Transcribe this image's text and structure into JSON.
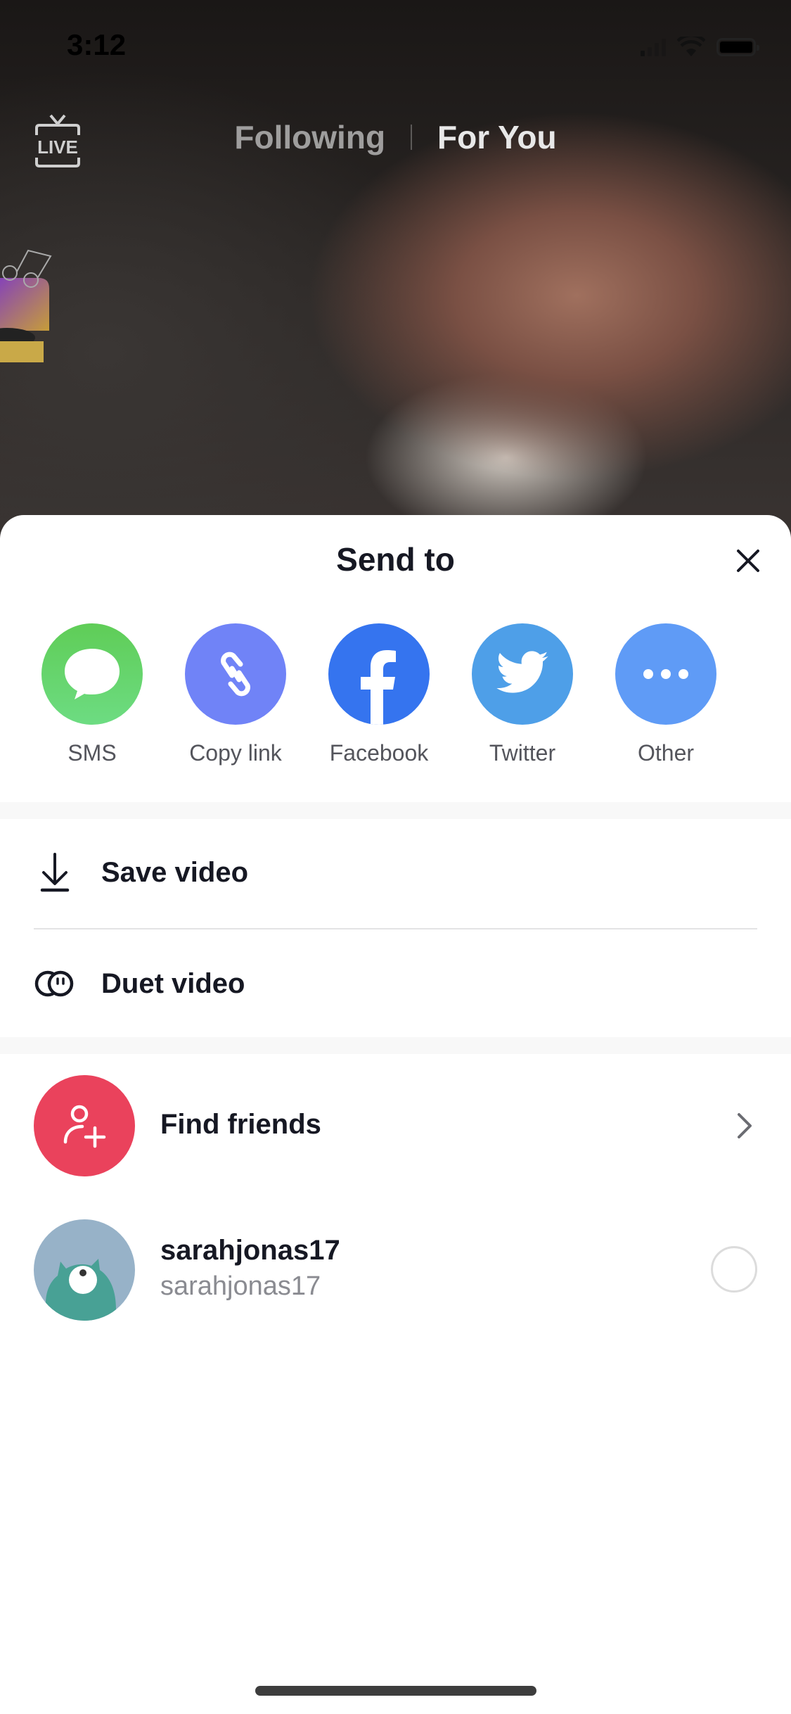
{
  "status_bar": {
    "time": "3:12"
  },
  "top_nav": {
    "live_label": "LIVE",
    "tabs": [
      {
        "label": "Following",
        "active": false
      },
      {
        "label": "For You",
        "active": true
      }
    ]
  },
  "share_sheet": {
    "title": "Send to",
    "close_icon": "close-icon",
    "share_targets": [
      {
        "label": "SMS",
        "icon": "message-bubble-icon",
        "color": "#5fd068"
      },
      {
        "label": "Copy link",
        "icon": "link-icon",
        "color": "#7083f7"
      },
      {
        "label": "Facebook",
        "icon": "facebook-icon",
        "color": "#3574ef"
      },
      {
        "label": "Twitter",
        "icon": "twitter-icon",
        "color": "#4e9fe8"
      },
      {
        "label": "Other",
        "icon": "more-dots-icon",
        "color": "#5f9bf6"
      }
    ],
    "actions": [
      {
        "label": "Save video",
        "icon": "download-icon"
      },
      {
        "label": "Duet video",
        "icon": "duet-icon"
      }
    ],
    "find_friends": {
      "label": "Find friends",
      "icon": "add-user-icon",
      "color": "#ea425c"
    },
    "contacts": [
      {
        "display_name": "sarahjonas17",
        "username": "sarahjonas17",
        "selected": false
      }
    ]
  }
}
